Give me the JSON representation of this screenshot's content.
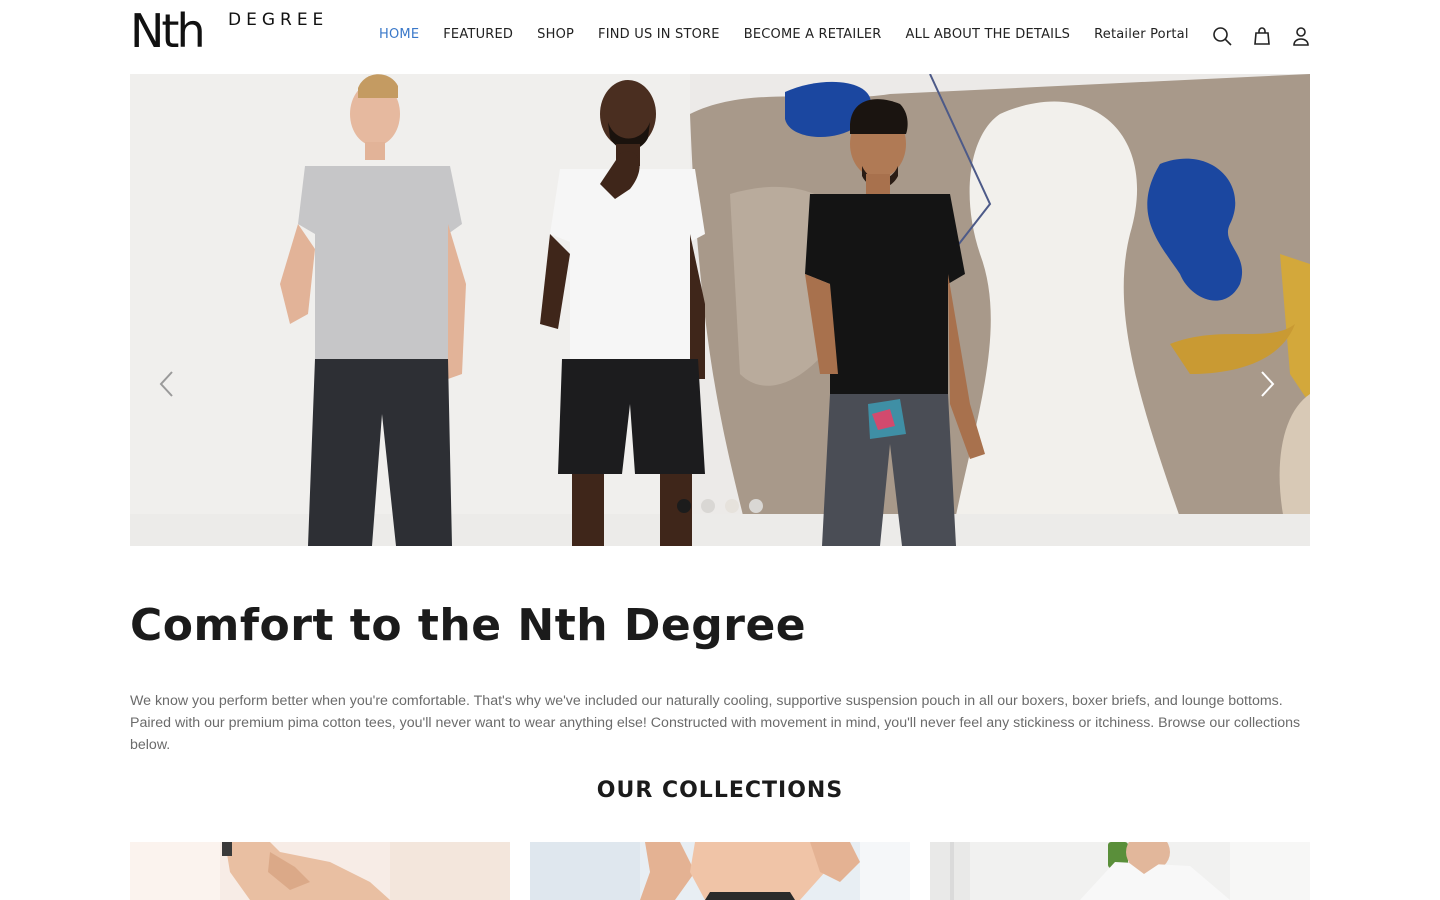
{
  "brand": {
    "logo_main": "Nth",
    "logo_sub": "DEGREE"
  },
  "nav": {
    "items": [
      {
        "label": "HOME",
        "active": true
      },
      {
        "label": "FEATURED",
        "active": false
      },
      {
        "label": "SHOP",
        "active": false
      },
      {
        "label": "FIND US IN STORE",
        "active": false
      },
      {
        "label": "BECOME A RETAILER",
        "active": false
      },
      {
        "label": "ALL ABOUT THE DETAILS",
        "active": false
      },
      {
        "label": "Retailer Portal",
        "active": false
      }
    ],
    "icons": [
      "search-icon",
      "cart-icon",
      "account-icon"
    ]
  },
  "hero": {
    "slide_count": 4,
    "active_slide": 1,
    "arrows": [
      "chevron-left-icon",
      "chevron-right-icon"
    ]
  },
  "content": {
    "headline": "Comfort to the Nth Degree",
    "intro": "We know you perform better when you're comfortable. That's why we've included our naturally cooling, supportive suspension pouch in all our boxers, boxer briefs, and lounge bottoms. Paired with our premium pima cotton tees, you'll never want to wear anything else! Constructed with movement in mind, you'll never feel any stickiness or itchiness. Browse our collections below.",
    "collections_title": "OUR COLLECTIONS"
  },
  "colors": {
    "accent": "#3a78c9",
    "text": "#1b1b1b",
    "muted": "#6b6b6b",
    "dot_active": "#1c1c1c"
  }
}
